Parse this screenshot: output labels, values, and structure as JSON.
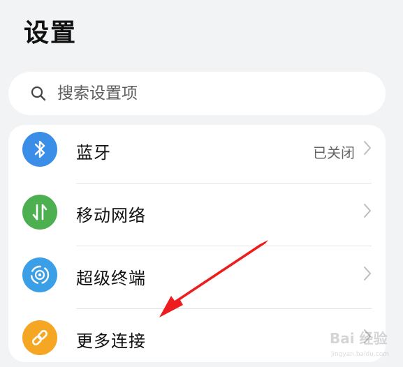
{
  "page": {
    "title": "设置"
  },
  "search": {
    "placeholder": "搜索设置项",
    "icon": "search-icon"
  },
  "settings": {
    "items": [
      {
        "label": "蓝牙",
        "status": "已关闭",
        "icon": "bluetooth-icon",
        "color": "#3b8ee8"
      },
      {
        "label": "移动网络",
        "status": "",
        "icon": "mobile-data-icon",
        "color": "#4caf50"
      },
      {
        "label": "超级终端",
        "status": "",
        "icon": "super-device-icon",
        "color": "#3a9fe6"
      },
      {
        "label": "更多连接",
        "status": "",
        "icon": "link-icon",
        "color": "#f5a623"
      }
    ]
  },
  "annotation": {
    "arrow_color": "#ee1c1c"
  },
  "watermark": {
    "logo": "Bai 经验",
    "url": "jingyan.baidu.com"
  }
}
